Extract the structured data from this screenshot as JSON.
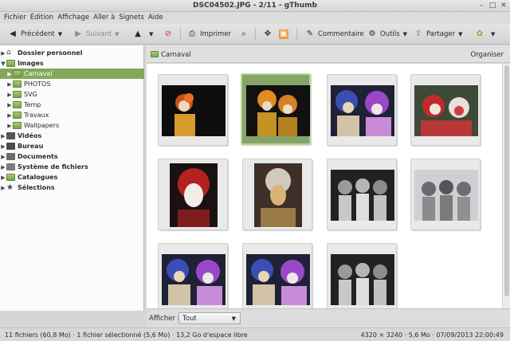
{
  "window": {
    "title": "DSC04502.JPG - 2/11 - gThumb",
    "minimize": "–",
    "maximize": "□",
    "close": "✕"
  },
  "menu": [
    "Fichier",
    "Édition",
    "Affichage",
    "Aller à",
    "Signets",
    "Aide"
  ],
  "toolbar": {
    "prev": "Précédent",
    "next": "Suivant",
    "print": "Imprimer",
    "comment": "Commentaire",
    "tools": "Outils",
    "share": "Partager"
  },
  "sidebar": {
    "items": [
      {
        "label": "Dossier personnel",
        "bold": true
      },
      {
        "label": "Images",
        "bold": true
      },
      {
        "label": "Carnaval"
      },
      {
        "label": "PHOTOS"
      },
      {
        "label": "SVG"
      },
      {
        "label": "Temp"
      },
      {
        "label": "Travaux"
      },
      {
        "label": "Wallpapers"
      },
      {
        "label": "Vidéos",
        "bold": true
      },
      {
        "label": "Bureau",
        "bold": true
      },
      {
        "label": "Documents",
        "bold": true
      },
      {
        "label": "Système de fichiers",
        "bold": true
      },
      {
        "label": "Catalogues",
        "bold": true
      },
      {
        "label": "Sélections",
        "bold": true
      }
    ]
  },
  "location": {
    "folder": "Carnaval",
    "organize": "Organiser"
  },
  "filter": {
    "label": "Afficher :",
    "value": "Tout"
  },
  "status": {
    "left": "11 fichiers (60,8 Mo) · 1 fichier sélectionné (5,6 Mo) · 13,2 Go d'espace libre",
    "right": "4320 × 3240 · 5,6 Mo · 07/09/2013 22:00:49"
  },
  "colors": {
    "selection_green": "#83a85b",
    "folder_green": "#78a44a"
  }
}
